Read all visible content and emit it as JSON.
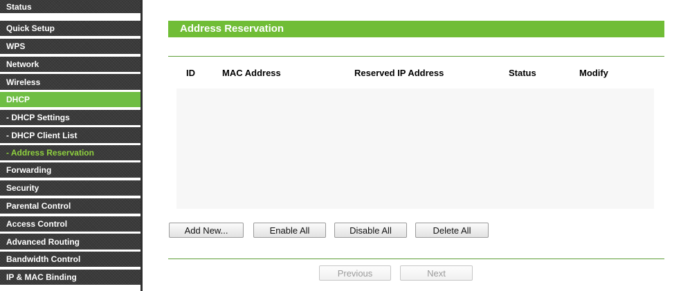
{
  "sidebar": {
    "items": [
      {
        "label": "Status"
      },
      {
        "label": "Quick Setup"
      },
      {
        "label": "WPS"
      },
      {
        "label": "Network"
      },
      {
        "label": "Wireless"
      },
      {
        "label": "DHCP",
        "active": true
      },
      {
        "label": "- DHCP Settings"
      },
      {
        "label": "- DHCP Client List"
      },
      {
        "label": "- Address Reservation",
        "selected": true
      },
      {
        "label": "Forwarding"
      },
      {
        "label": "Security"
      },
      {
        "label": "Parental Control"
      },
      {
        "label": "Access Control"
      },
      {
        "label": "Advanced Routing"
      },
      {
        "label": "Bandwidth Control"
      },
      {
        "label": "IP & MAC Binding"
      }
    ]
  },
  "main": {
    "title": "Address Reservation",
    "table": {
      "columns": [
        "ID",
        "MAC Address",
        "Reserved IP Address",
        "Status",
        "Modify"
      ],
      "rows": []
    },
    "actions": {
      "add_new": "Add New...",
      "enable_all": "Enable All",
      "disable_all": "Disable All",
      "delete_all": "Delete All"
    },
    "pagination": {
      "previous": "Previous",
      "next": "Next"
    }
  },
  "colors": {
    "accent_green": "#70bd36",
    "sidebar_dark": "#3b3b3b",
    "selected_text": "#8fd13f"
  }
}
